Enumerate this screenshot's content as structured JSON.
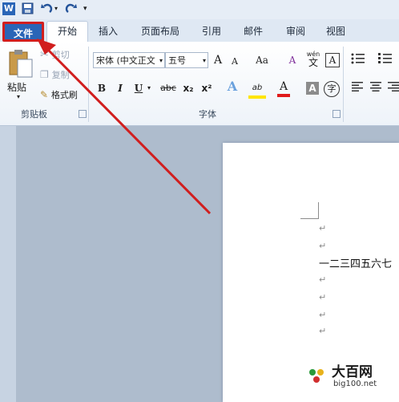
{
  "ribbon_tabs": {
    "file": "文件",
    "home": "开始",
    "insert": "插入",
    "layout": "页面布局",
    "references": "引用",
    "mailings": "邮件",
    "review": "审阅",
    "view": "视图"
  },
  "clipboard": {
    "paste": "粘贴",
    "cut": "剪切",
    "copy": "复制",
    "format_painter": "格式刷",
    "group_label": "剪贴板"
  },
  "font": {
    "font_name": "宋体 (中文正文",
    "font_size": "五号",
    "group_label": "字体",
    "bold": "B",
    "italic": "I",
    "underline": "U",
    "strike": "abc",
    "subscript": "x₂",
    "superscript": "x²",
    "grow": "A",
    "shrink": "A",
    "case": "Aa",
    "phonetic": "wén",
    "phonetic_char": "文",
    "char_border": "A",
    "enclose": "字",
    "clear_format": "A",
    "text_effect": "A",
    "font_color": "A",
    "char_shading": "A",
    "highlight": "ab"
  },
  "document": {
    "line1": "↵",
    "line2": "一二三四五六七",
    "line3": "↵",
    "line4": "↵",
    "line5": "↵",
    "line6": "↵",
    "line0": "↵"
  },
  "watermark": {
    "brand": "大百网",
    "url": "big100.net"
  },
  "colors": {
    "file_tab": "#2a65b7",
    "annotation": "#d11e1e",
    "window_bg": "#aebccd"
  }
}
